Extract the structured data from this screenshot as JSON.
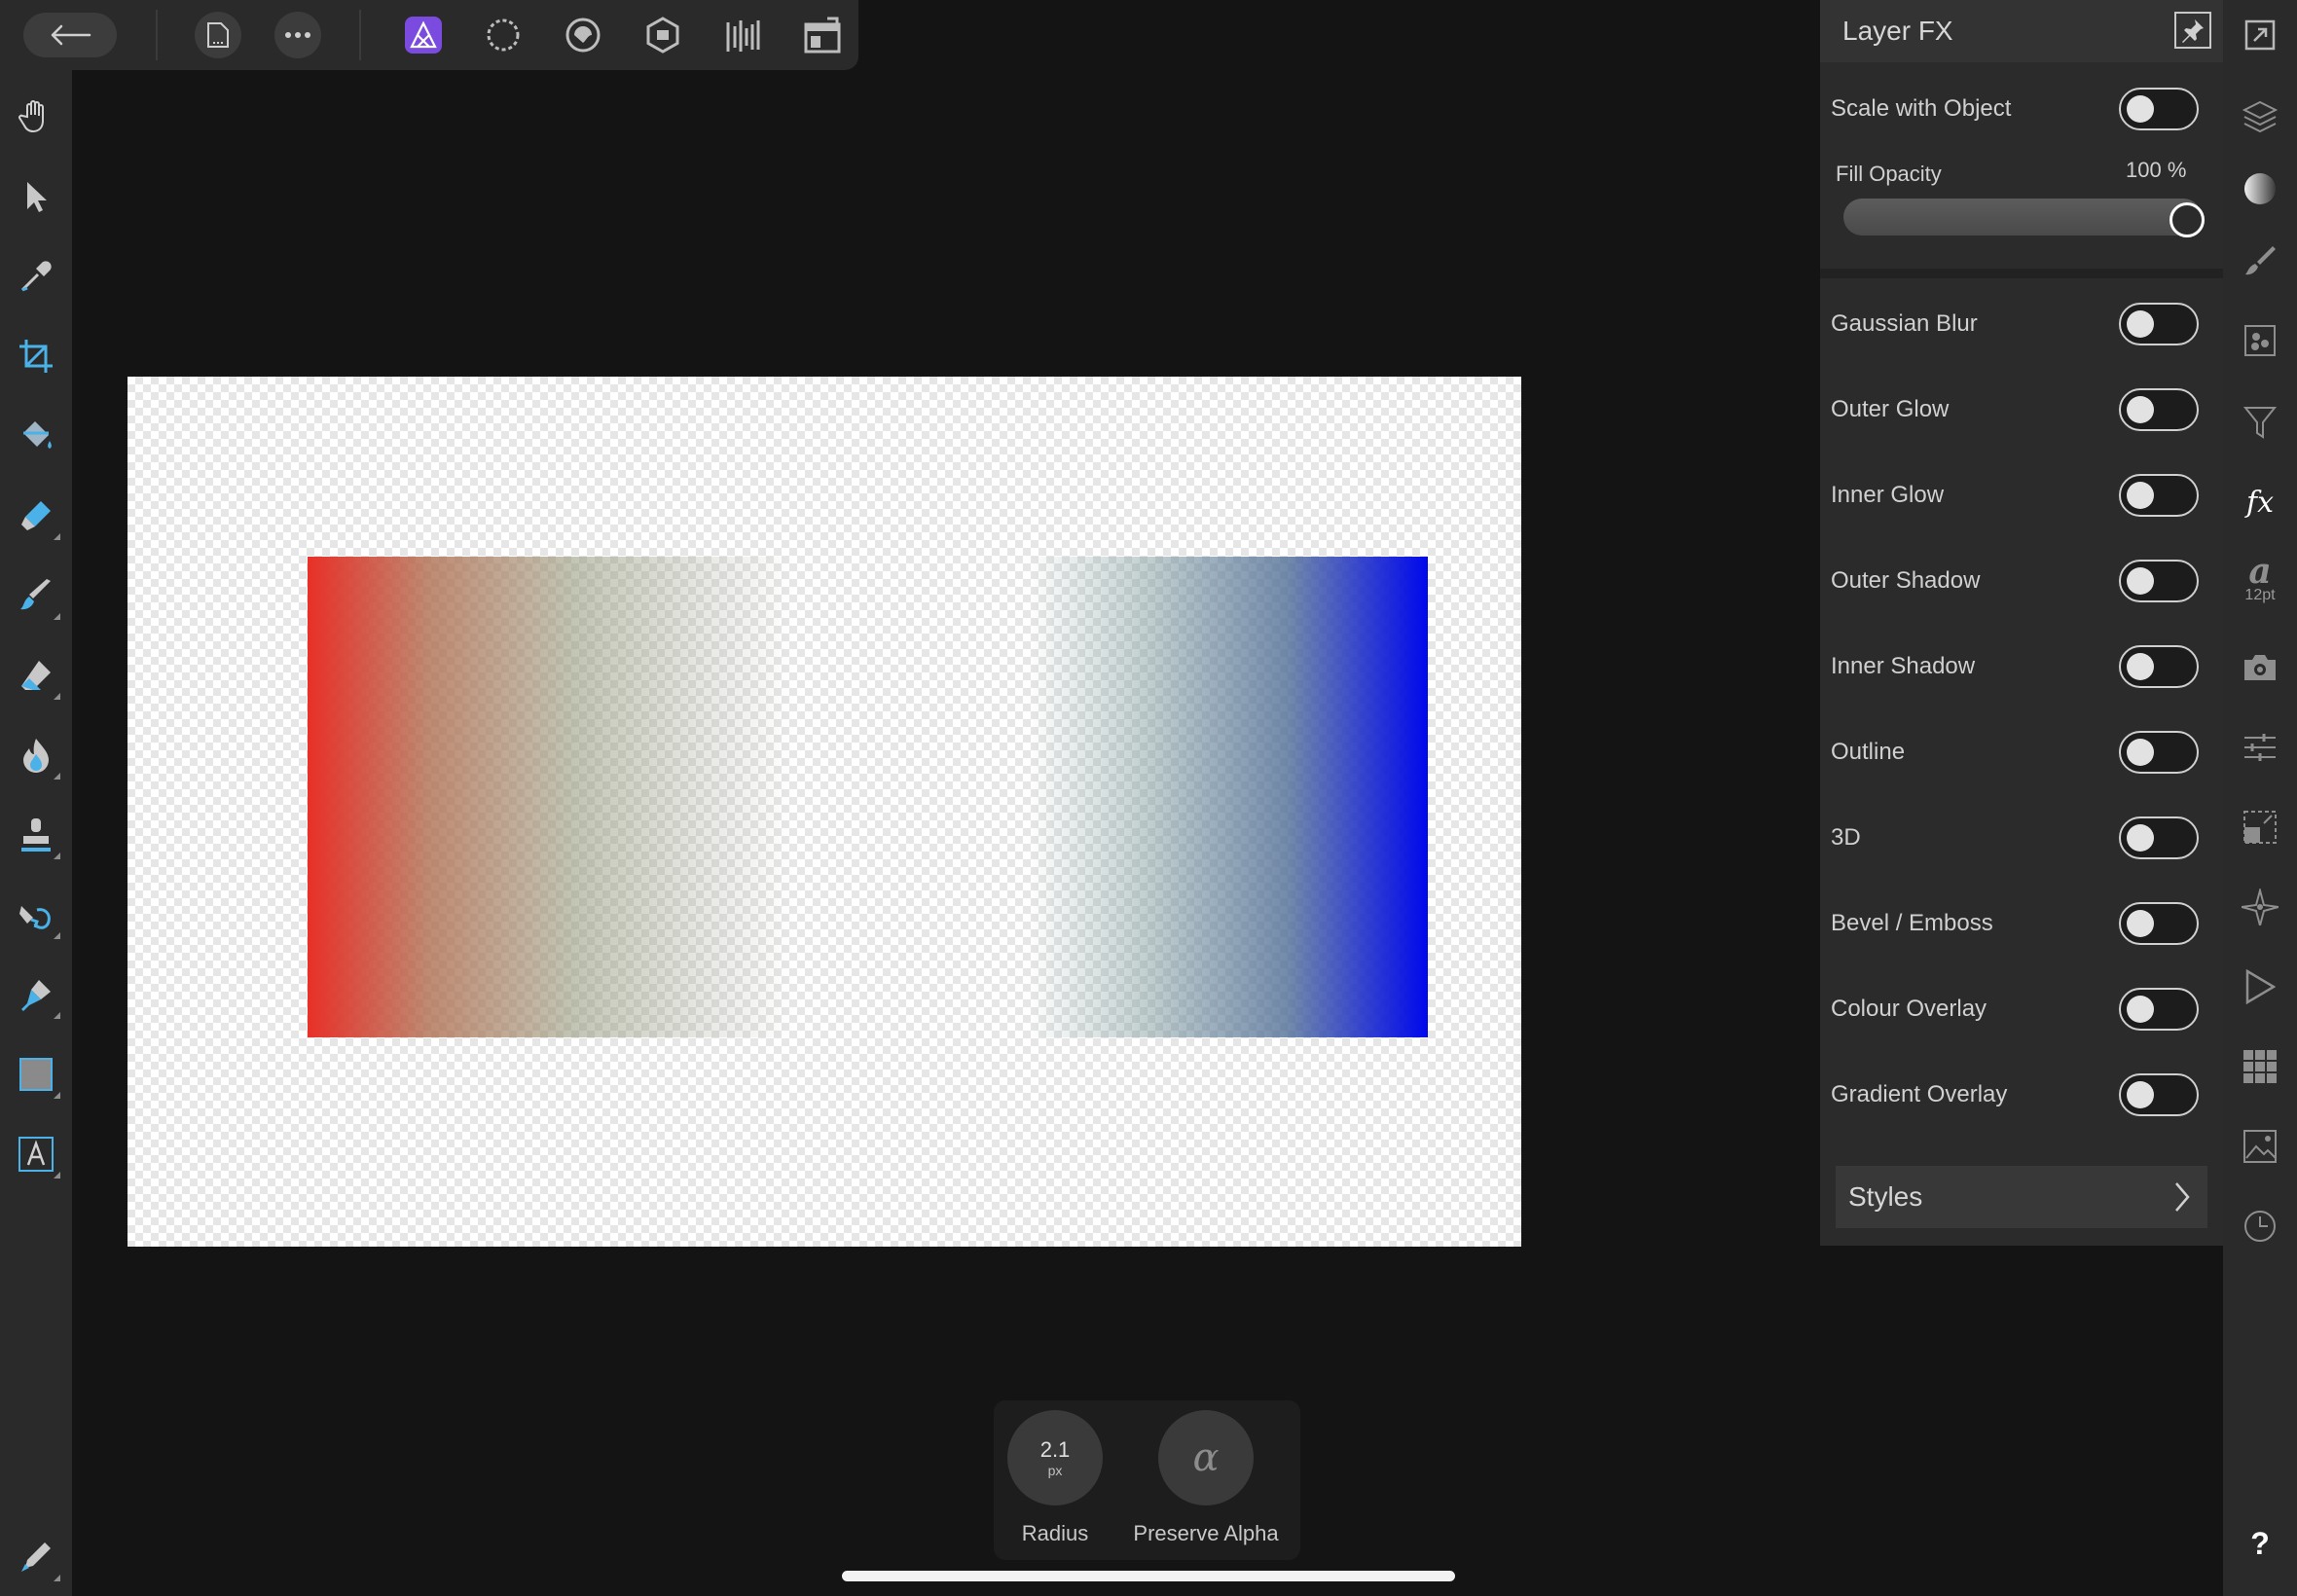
{
  "top_bar": {
    "icons": [
      "back-arrow-icon",
      "document-icon",
      "more-icon",
      "photo-persona-icon",
      "liquify-persona-icon",
      "develop-persona-icon",
      "tone-mapping-persona-icon",
      "export-persona-icon",
      "panels-icon"
    ]
  },
  "left_tools": [
    "hand-icon",
    "move-icon",
    "color-picker-icon",
    "crop-icon",
    "flood-fill-icon",
    "selection-brush-icon",
    "paint-brush-icon",
    "erase-brush-icon",
    "dodge-burn-icon",
    "clone-stamp-icon",
    "smudge-icon",
    "pen-icon",
    "rectangle-icon",
    "text-icon",
    "quick-menu-icon"
  ],
  "accent_color": "#7b4bdf",
  "layer_fx": {
    "title": "Layer FX",
    "scale_with_object": "Scale with Object",
    "fill_opacity_label": "Fill Opacity",
    "fill_opacity_value": "100 %",
    "fill_opacity_fraction": 1.0,
    "effects": [
      {
        "label": "Gaussian Blur",
        "on": false
      },
      {
        "label": "Outer Glow",
        "on": false
      },
      {
        "label": "Inner Glow",
        "on": false
      },
      {
        "label": "Outer Shadow",
        "on": false
      },
      {
        "label": "Inner Shadow",
        "on": false
      },
      {
        "label": "Outline",
        "on": false
      },
      {
        "label": "3D",
        "on": false
      },
      {
        "label": "Bevel / Emboss",
        "on": false
      },
      {
        "label": "Colour Overlay",
        "on": false
      },
      {
        "label": "Gradient Overlay",
        "on": false
      }
    ],
    "styles_label": "Styles"
  },
  "context": {
    "radius_value": "2.1",
    "radius_unit": "px",
    "radius_label": "Radius",
    "preserve_alpha_glyph": "α",
    "preserve_alpha_label": "Preserve Alpha"
  },
  "studio": {
    "text_style_glyph": "a",
    "text_size": "12pt",
    "help_glyph": "?"
  },
  "canvas": {
    "left_gradient": [
      "#e83028",
      "#a0a58a"
    ],
    "right_gradient": [
      "#8a9c9e",
      "#0008ec"
    ]
  }
}
